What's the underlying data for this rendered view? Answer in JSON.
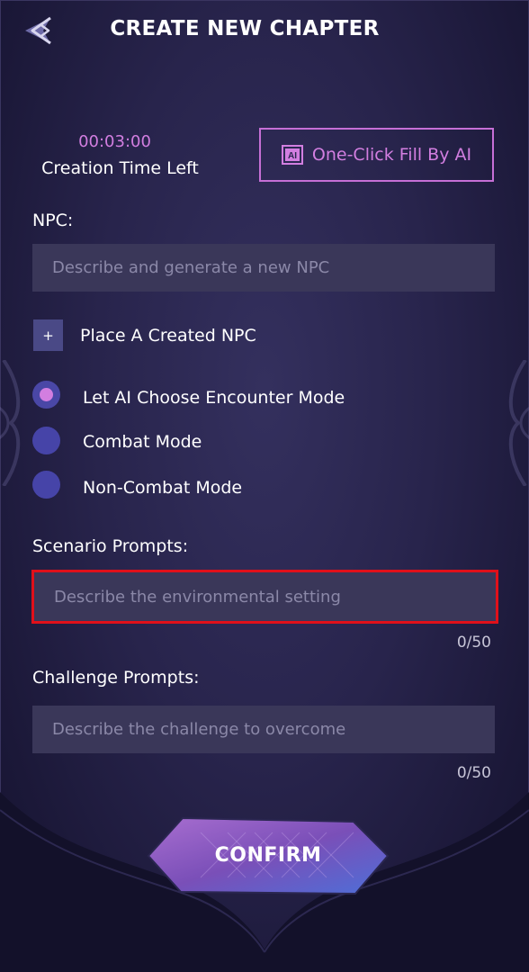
{
  "header": {
    "title": "CREATE NEW CHAPTER"
  },
  "timer": {
    "value": "00:03:00",
    "label": "Creation Time Left"
  },
  "ai_fill_button": {
    "icon_text": "AI",
    "label": "One-Click Fill By AI"
  },
  "npc": {
    "label": "NPC:",
    "placeholder": "Describe and generate a new NPC",
    "add_button": "+",
    "place_label": "Place A Created NPC"
  },
  "encounter_modes": [
    {
      "label": "Let AI Choose Encounter Mode",
      "selected": true
    },
    {
      "label": "Combat Mode",
      "selected": false
    },
    {
      "label": "Non-Combat Mode",
      "selected": false
    }
  ],
  "scenario": {
    "label": "Scenario Prompts:",
    "placeholder": "Describe the environmental setting",
    "counter": "0/50"
  },
  "challenge": {
    "label": "Challenge Prompts:",
    "placeholder": "Describe the challenge to overcome",
    "counter": "0/50"
  },
  "confirm": {
    "label": "CONFIRM"
  },
  "colors": {
    "accent": "#d27ee0",
    "radio": "#4644a8",
    "field_bg": "#3a3759",
    "highlight": "#e0101a"
  }
}
